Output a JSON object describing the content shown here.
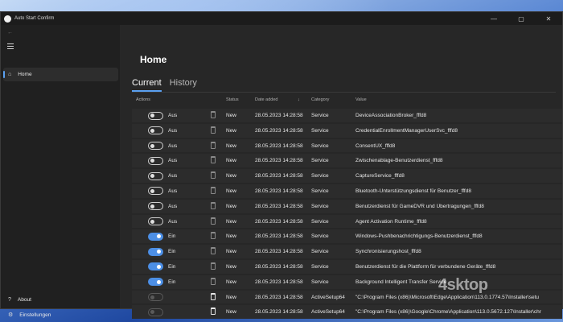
{
  "window": {
    "title": "Auto Start Confirm"
  },
  "sidebar": {
    "home_label": "Home",
    "about_label": "About",
    "settings_label": "Einstellungen"
  },
  "main": {
    "title": "Home",
    "tabs": [
      {
        "label": "Current"
      },
      {
        "label": "History"
      }
    ],
    "columns": {
      "actions": "Actions",
      "status": "Status",
      "date_added": "Date added",
      "category": "Category",
      "value": "Value"
    },
    "rows": [
      {
        "toggle": "Aus",
        "status": "New",
        "date": "28.05.2023 14:28:58",
        "category": "Service",
        "value": "DeviceAssociationBroker_fffd8"
      },
      {
        "toggle": "Aus",
        "status": "New",
        "date": "28.05.2023 14:28:58",
        "category": "Service",
        "value": "CredentialEnrollmentManagerUserSvc_fffd8"
      },
      {
        "toggle": "Aus",
        "status": "New",
        "date": "28.05.2023 14:28:58",
        "category": "Service",
        "value": "ConsentUX_fffd8"
      },
      {
        "toggle": "Aus",
        "status": "New",
        "date": "28.05.2023 14:28:58",
        "category": "Service",
        "value": "Zwischenablage-Benutzerdienst_fffd8"
      },
      {
        "toggle": "Aus",
        "status": "New",
        "date": "28.05.2023 14:28:58",
        "category": "Service",
        "value": "CaptureService_fffd8"
      },
      {
        "toggle": "Aus",
        "status": "New",
        "date": "28.05.2023 14:28:58",
        "category": "Service",
        "value": "Bluetooth-Unterstützungsdienst für Benutzer_fffd8"
      },
      {
        "toggle": "Aus",
        "status": "New",
        "date": "28.05.2023 14:28:58",
        "category": "Service",
        "value": "Benutzerdienst für GameDVR und Übertragungen_fffd8"
      },
      {
        "toggle": "Aus",
        "status": "New",
        "date": "28.05.2023 14:28:58",
        "category": "Service",
        "value": "Agent Activation Runtime_fffd8"
      },
      {
        "toggle": "Ein",
        "status": "New",
        "date": "28.05.2023 14:28:58",
        "category": "Service",
        "value": "Windows-Pushbenachrichtigungs-Benutzerdienst_fffd8"
      },
      {
        "toggle": "Ein",
        "status": "New",
        "date": "28.05.2023 14:28:58",
        "category": "Service",
        "value": "Synchronisierungshost_fffd8"
      },
      {
        "toggle": "Ein",
        "status": "New",
        "date": "28.05.2023 14:28:58",
        "category": "Service",
        "value": "Benutzerdienst für die Plattform für verbundene Geräte_fffd8"
      },
      {
        "toggle": "Ein",
        "status": "New",
        "date": "28.05.2023 14:28:58",
        "category": "Service",
        "value": "Background Intelligent Transfer Service"
      },
      {
        "toggle": "",
        "status": "New",
        "date": "28.05.2023 14:28:58",
        "category": "ActiveSetup64",
        "value": "\"C:\\Program Files (x86)\\Microsoft\\Edge\\Application\\113.0.1774.57\\Installer\\setu"
      },
      {
        "toggle": "",
        "status": "New",
        "date": "28.05.2023 14:28:58",
        "category": "ActiveSetup64",
        "value": "\"C:\\Program Files (x86)\\Google\\Chrome\\Application\\113.0.5672.127\\Installer\\chr"
      }
    ]
  },
  "watermark": "4sktop",
  "icons": {
    "app": "app-circle-icon",
    "back": "back-arrow-icon",
    "menu": "hamburger-icon",
    "home": "home-icon",
    "about": "question-icon",
    "settings": "gear-icon",
    "delete": "trash-icon",
    "sort": "sort-down-icon"
  },
  "colors": {
    "accent": "#4c8fe6",
    "background": "#202020"
  }
}
